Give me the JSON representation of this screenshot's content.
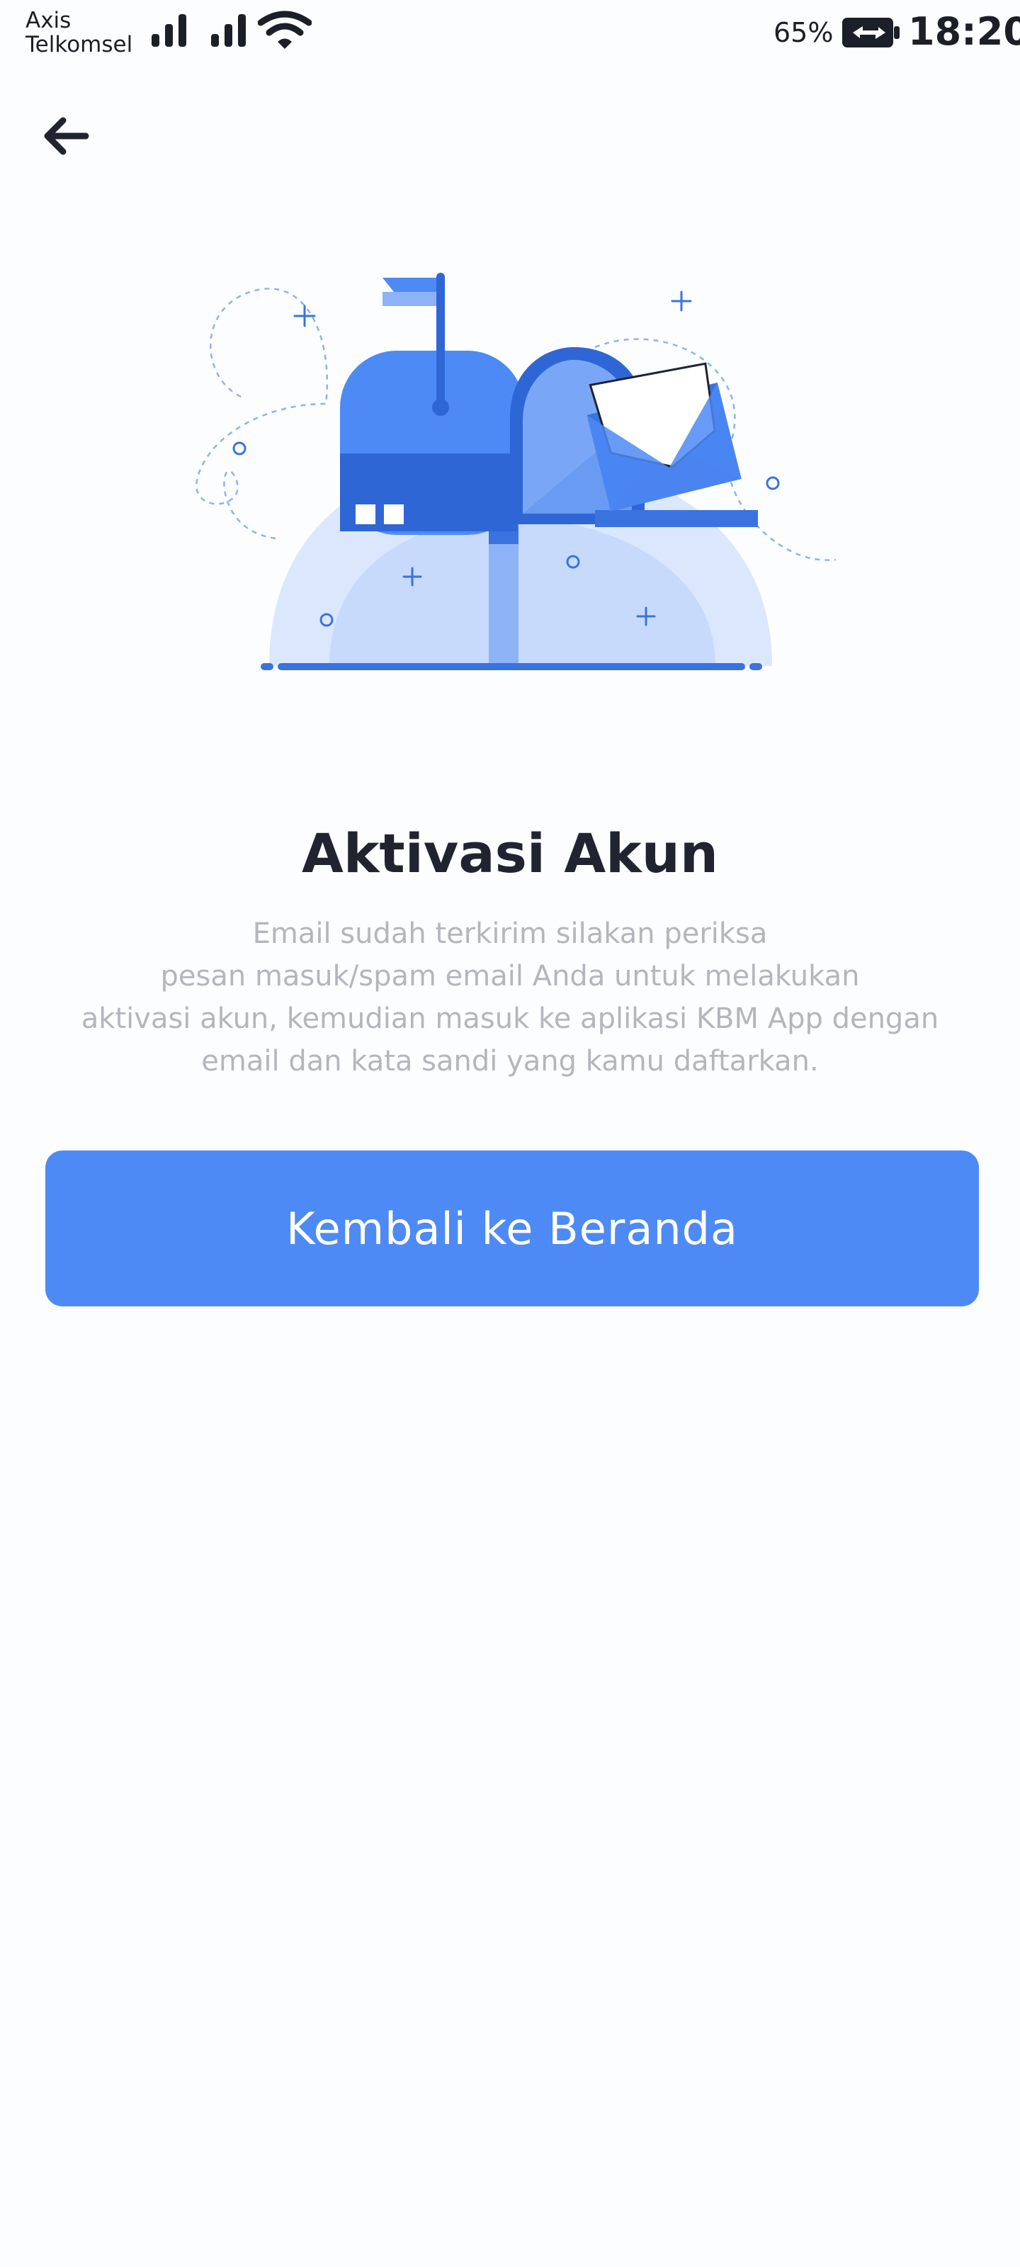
{
  "status_bar": {
    "carrier_line1": "Axis",
    "carrier_line2": "Telkomsel",
    "battery_percent": "65%",
    "time": "18:20",
    "icons": [
      "signal-icon",
      "signal-icon",
      "wifi-icon",
      "battery-charging-icon"
    ]
  },
  "header": {
    "back_icon": "arrow-left-icon"
  },
  "illustration": {
    "name": "mailbox-with-envelope"
  },
  "content": {
    "title": "Aktivasi Akun",
    "description_lines": [
      "Email sudah terkirim silakan periksa",
      "pesan masuk/spam email Anda untuk melakukan",
      "aktivasi akun, kemudian masuk ke aplikasi KBM App dengan",
      "email dan kata sandi yang kamu daftarkan."
    ]
  },
  "actions": {
    "primary_label": "Kembali ke Beranda"
  },
  "colors": {
    "primary": "#4d8af6",
    "title": "#1f2430",
    "description": "#b4b6be",
    "background": "#fcfdfe"
  }
}
